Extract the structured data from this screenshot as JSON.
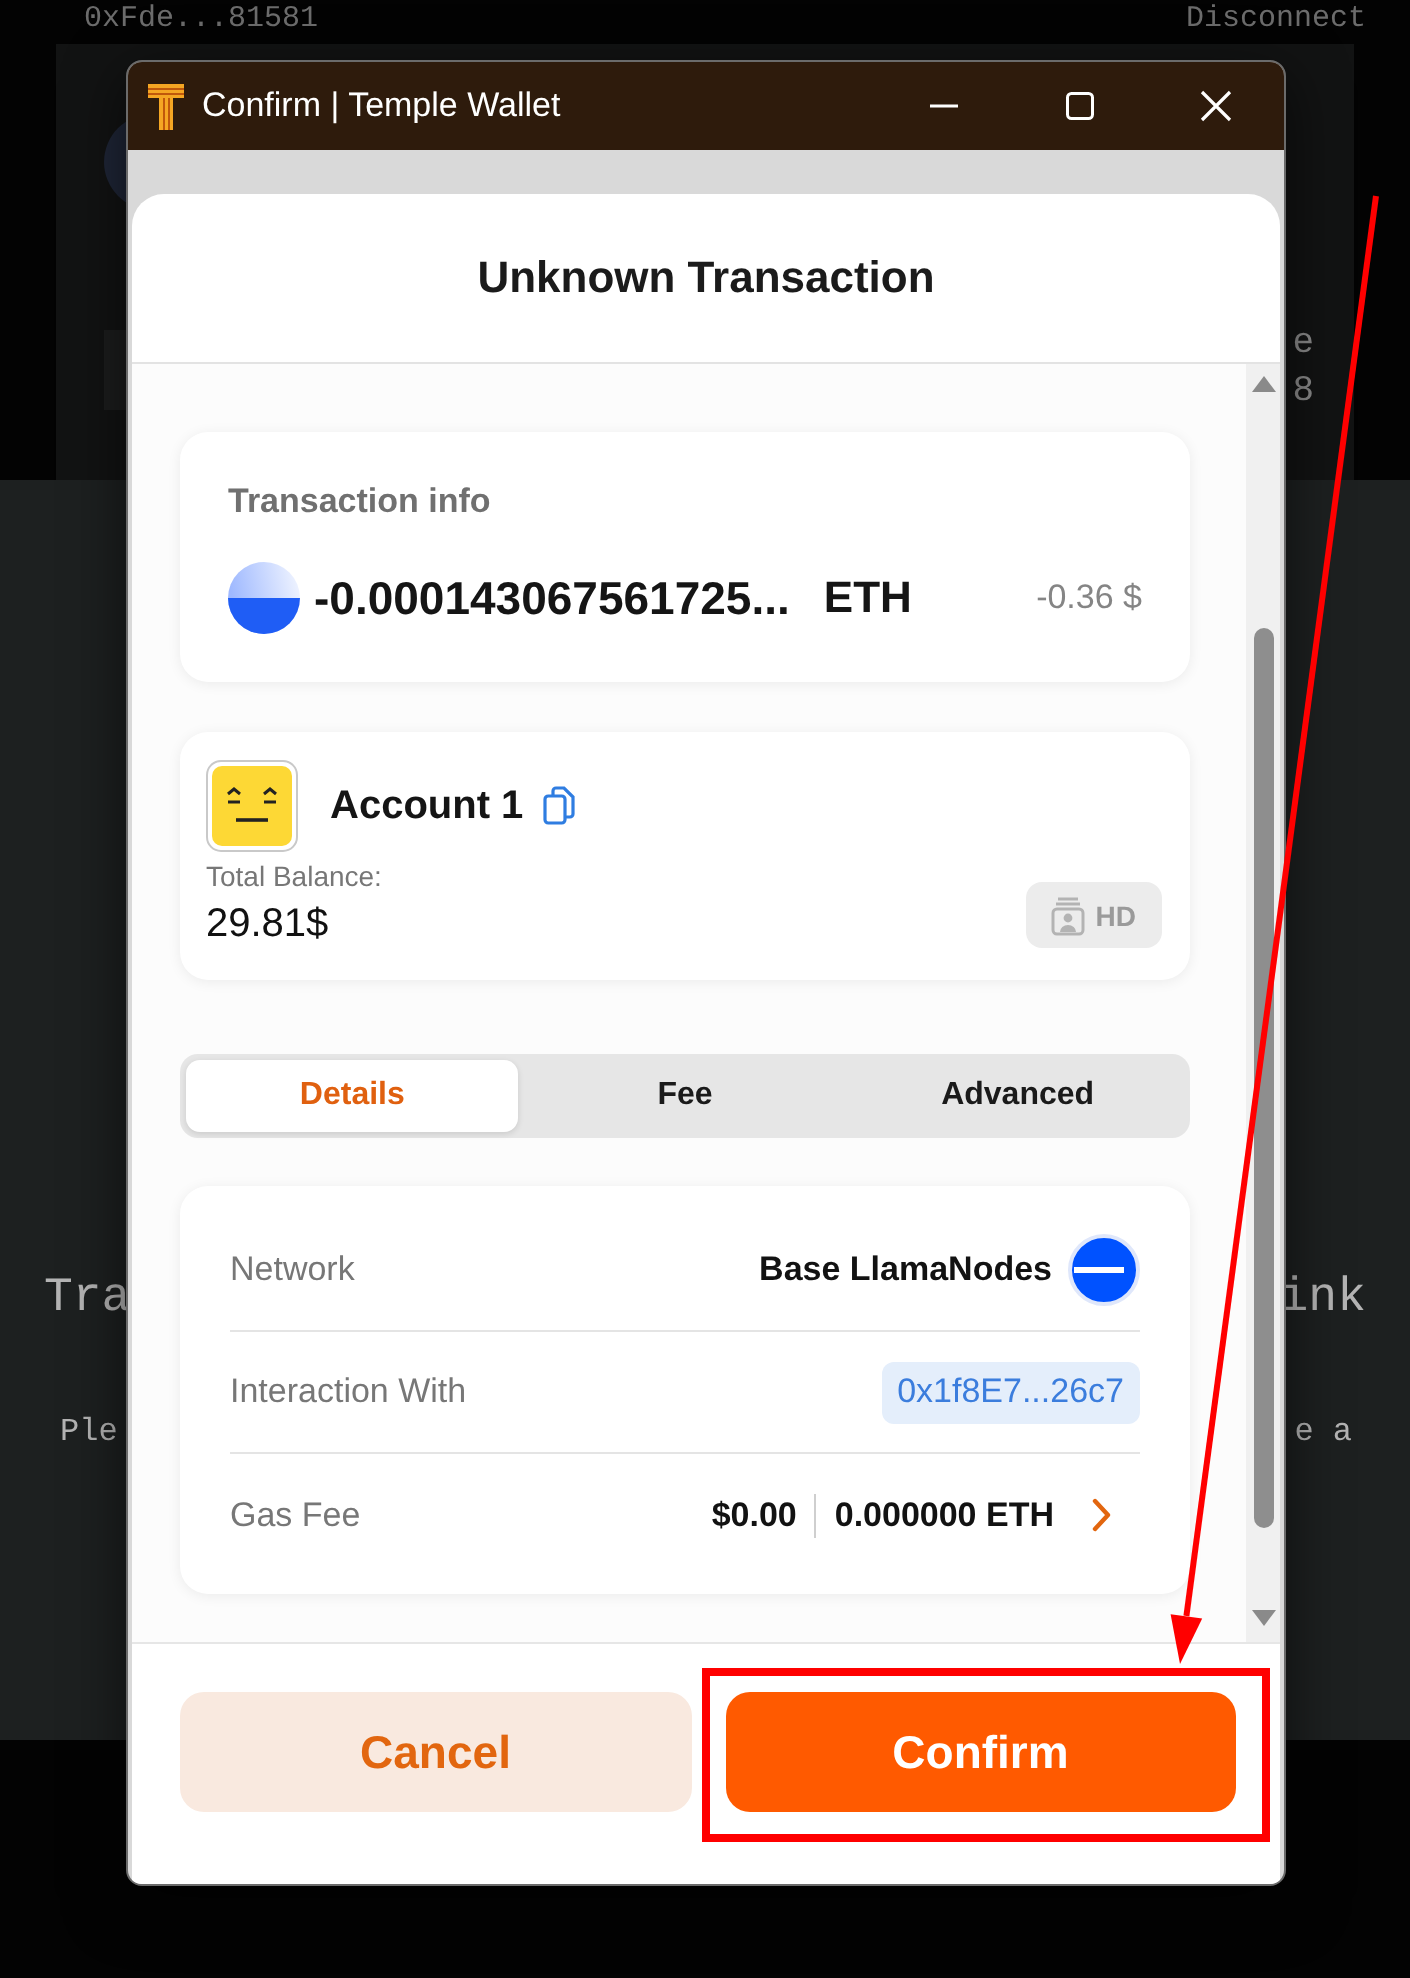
{
  "background": {
    "address": "0xFde...81581",
    "disconnect": "Disconnect",
    "stat_line_1": "e",
    "stat_line_2": "8",
    "heading_left": "Tra",
    "heading_right": "ink",
    "note_left": "Ple",
    "note_right": "e a"
  },
  "window": {
    "title": "Confirm | Temple Wallet"
  },
  "header": {
    "title": "Unknown Transaction"
  },
  "transaction_info": {
    "title": "Transaction info",
    "amount": "-0.000143067561725...",
    "symbol": "ETH",
    "fiat": "-0.36 $"
  },
  "account": {
    "name": "Account 1",
    "balance_label": "Total Balance:",
    "balance": "29.81$",
    "badge": "HD"
  },
  "tabs": [
    {
      "label": "Details",
      "selected": true
    },
    {
      "label": "Fee",
      "selected": false
    },
    {
      "label": "Advanced",
      "selected": false
    }
  ],
  "details": [
    {
      "kind": "network",
      "label": "Network",
      "value": "Base LlamaNodes"
    },
    {
      "kind": "address",
      "label": "Interaction With",
      "value": "0x1f8E7...26c7"
    },
    {
      "kind": "fee",
      "label": "Gas Fee",
      "fiat": "$0.00",
      "amount": "0.000000 ETH"
    }
  ],
  "buttons": [
    {
      "kind": "secondary",
      "label": "Cancel"
    },
    {
      "kind": "primary",
      "label": "Confirm"
    }
  ]
}
